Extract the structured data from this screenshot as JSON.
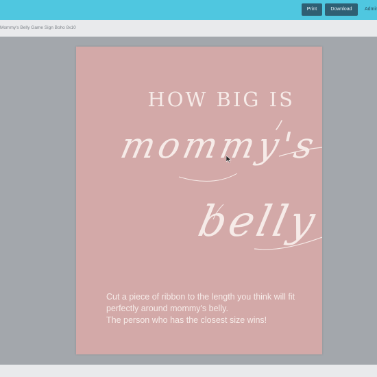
{
  "toolbar": {
    "print_label": "Print",
    "download_label": "Download",
    "admin_label": "Admin"
  },
  "document": {
    "title": "Mommy's Belly Game Sign Boho 8x10"
  },
  "sign": {
    "headline": "HOW BIG IS",
    "script_line1": "mommy's",
    "script_line2": "belly",
    "body_line1": "Cut a piece of ribbon to the length you think will fit",
    "body_line2": "perfectly around mommy's belly.",
    "body_line3": "The person who has the closest size wins!",
    "background_color": "#d3a9a8",
    "text_color": "#f6ebe8"
  }
}
